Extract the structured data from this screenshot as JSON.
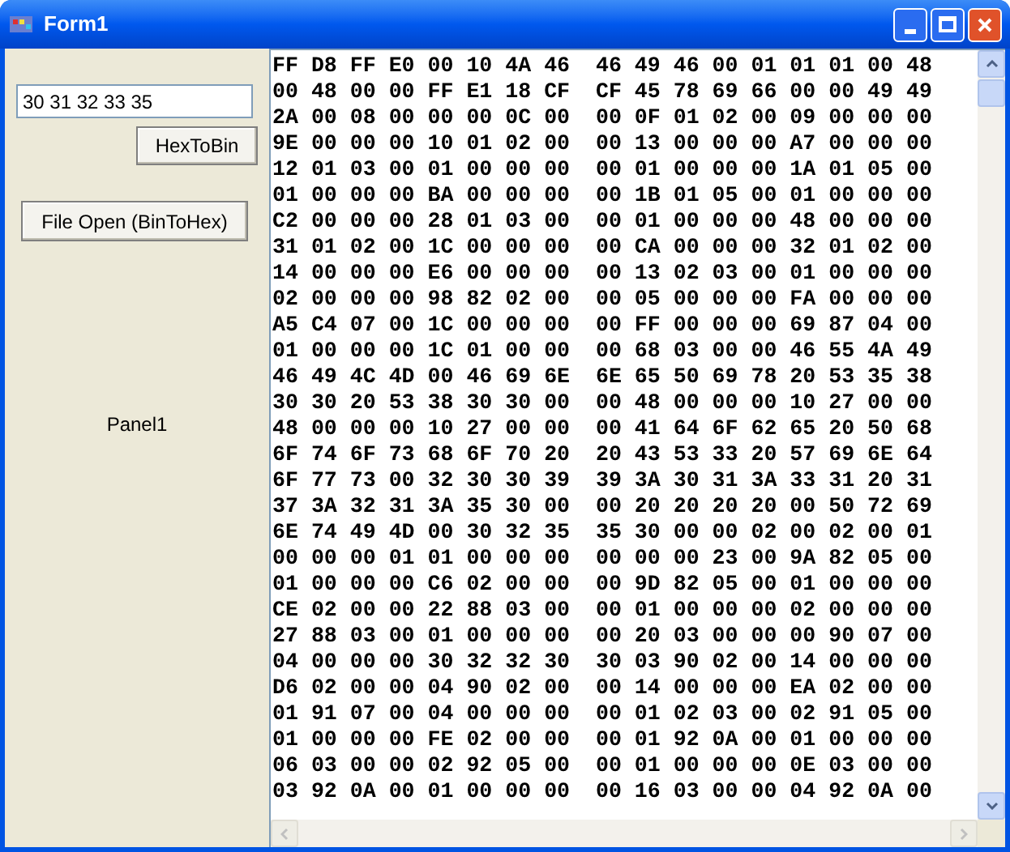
{
  "window": {
    "title": "Form1"
  },
  "hex_input": {
    "value": "30 31 32 33 35"
  },
  "buttons": [
    {
      "label": "HexToBin"
    },
    {
      "label": "File Open (BinToHex)"
    }
  ],
  "panel": {
    "caption": "Panel1"
  },
  "hex_rows": [
    "FF D8 FF E0 00 10 4A 46  46 49 46 00 01 01 01 00 48",
    "00 48 00 00 FF E1 18 CF  CF 45 78 69 66 00 00 49 49",
    "2A 00 08 00 00 00 0C 00  00 0F 01 02 00 09 00 00 00",
    "9E 00 00 00 10 01 02 00  00 13 00 00 00 A7 00 00 00",
    "12 01 03 00 01 00 00 00  00 01 00 00 00 1A 01 05 00",
    "01 00 00 00 BA 00 00 00  00 1B 01 05 00 01 00 00 00",
    "C2 00 00 00 28 01 03 00  00 01 00 00 00 48 00 00 00",
    "31 01 02 00 1C 00 00 00  00 CA 00 00 00 32 01 02 00",
    "14 00 00 00 E6 00 00 00  00 13 02 03 00 01 00 00 00",
    "02 00 00 00 98 82 02 00  00 05 00 00 00 FA 00 00 00",
    "A5 C4 07 00 1C 00 00 00  00 FF 00 00 00 69 87 04 00",
    "01 00 00 00 1C 01 00 00  00 68 03 00 00 46 55 4A 49",
    "46 49 4C 4D 00 46 69 6E  6E 65 50 69 78 20 53 35 38",
    "30 30 20 53 38 30 30 00  00 48 00 00 00 10 27 00 00",
    "48 00 00 00 10 27 00 00  00 41 64 6F 62 65 20 50 68",
    "6F 74 6F 73 68 6F 70 20  20 43 53 33 20 57 69 6E 64",
    "6F 77 73 00 32 30 30 39  39 3A 30 31 3A 33 31 20 31",
    "37 3A 32 31 3A 35 30 00  00 20 20 20 20 00 50 72 69",
    "6E 74 49 4D 00 30 32 35  35 30 00 00 02 00 02 00 01",
    "00 00 00 01 01 00 00 00  00 00 00 23 00 9A 82 05 00",
    "01 00 00 00 C6 02 00 00  00 9D 82 05 00 01 00 00 00",
    "CE 02 00 00 22 88 03 00  00 01 00 00 00 02 00 00 00",
    "27 88 03 00 01 00 00 00  00 20 03 00 00 00 90 07 00",
    "04 00 00 00 30 32 32 30  30 03 90 02 00 14 00 00 00",
    "D6 02 00 00 04 90 02 00  00 14 00 00 00 EA 02 00 00",
    "01 91 07 00 04 00 00 00  00 01 02 03 00 02 91 05 00",
    "01 00 00 00 FE 02 00 00  00 01 92 0A 00 01 00 00 00",
    "06 03 00 00 02 92 05 00  00 01 00 00 00 0E 03 00 00",
    "03 92 0A 00 01 00 00 00  00 16 03 00 00 04 92 0A 00"
  ]
}
